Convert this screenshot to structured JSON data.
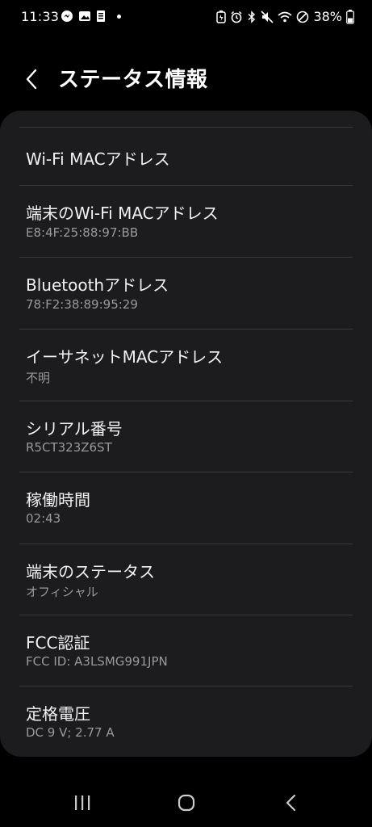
{
  "status_bar": {
    "time": "11:33",
    "battery_percent": "38%"
  },
  "header": {
    "title": "ステータス情報",
    "back_icon": "chevron-left-icon"
  },
  "items": [
    {
      "label": "Wi-Fi MACアドレス",
      "value": ""
    },
    {
      "label": "端末のWi-Fi MACアドレス",
      "value": "E8:4F:25:88:97:BB"
    },
    {
      "label": "Bluetoothアドレス",
      "value": "78:F2:38:89:95:29"
    },
    {
      "label": "イーサネットMACアドレス",
      "value": "不明"
    },
    {
      "label": "シリアル番号",
      "value": "R5CT323Z6ST"
    },
    {
      "label": "稼働時間",
      "value": "02:43"
    },
    {
      "label": "端末のステータス",
      "value": "オフィシャル"
    },
    {
      "label": "FCC認証",
      "value": "FCC ID: A3LSMG991JPN"
    },
    {
      "label": "定格電圧",
      "value": "DC 9 V; 2.77 A"
    }
  ],
  "navigation": {
    "recents_icon": "recent-apps-icon",
    "home_icon": "home-icon",
    "back_icon": "back-icon"
  },
  "colors": {
    "background": "#000000",
    "card": "#1c1c1e",
    "divider": "#3a3a3c",
    "secondary_text": "#9a9a9e"
  }
}
